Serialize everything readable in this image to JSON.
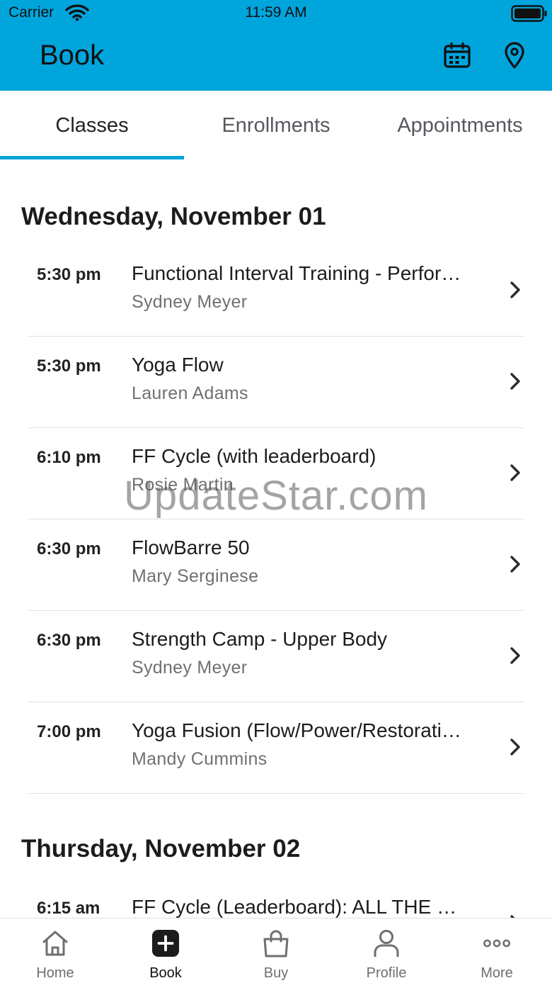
{
  "status_bar": {
    "carrier": "Carrier",
    "time": "11:59 AM"
  },
  "header": {
    "title": "Book",
    "icons": [
      "calendar-icon",
      "location-pin-icon"
    ]
  },
  "tabs": [
    {
      "label": "Classes",
      "active": true
    },
    {
      "label": "Enrollments",
      "active": false
    },
    {
      "label": "Appointments",
      "active": false
    }
  ],
  "days": [
    {
      "heading": "Wednesday, November 01",
      "classes": [
        {
          "time": "5:30 pm",
          "name": "Functional Interval Training - Perfor…",
          "instructor": "Sydney Meyer"
        },
        {
          "time": "5:30 pm",
          "name": "Yoga Flow",
          "instructor": "Lauren Adams"
        },
        {
          "time": "6:10 pm",
          "name": "FF Cycle (with leaderboard)",
          "instructor": "Rosie Martin"
        },
        {
          "time": "6:30 pm",
          "name": "FlowBarre 50",
          "instructor": "Mary Serginese"
        },
        {
          "time": "6:30 pm",
          "name": "Strength Camp - Upper Body",
          "instructor": "Sydney Meyer"
        },
        {
          "time": "7:00 pm",
          "name": "Yoga Fusion (Flow/Power/Restorati…",
          "instructor": "Mandy Cummins"
        }
      ]
    },
    {
      "heading": "Thursday, November 02",
      "classes": [
        {
          "time": "6:15 am",
          "name": "FF Cycle (Leaderboard): ALL THE …",
          "instructor": ""
        }
      ]
    }
  ],
  "watermark": "UpdateStar.com",
  "tab_bar": [
    {
      "label": "Home",
      "icon": "home-icon",
      "active": false
    },
    {
      "label": "Book",
      "icon": "plus-square-icon",
      "active": true
    },
    {
      "label": "Buy",
      "icon": "shopping-bag-icon",
      "active": false
    },
    {
      "label": "Profile",
      "icon": "person-icon",
      "active": false
    },
    {
      "label": "More",
      "icon": "more-dots-icon",
      "active": false
    }
  ],
  "colors": {
    "accent": "#00a5dc",
    "text": "#1c1c1e",
    "secondary_text": "#6e7074"
  }
}
